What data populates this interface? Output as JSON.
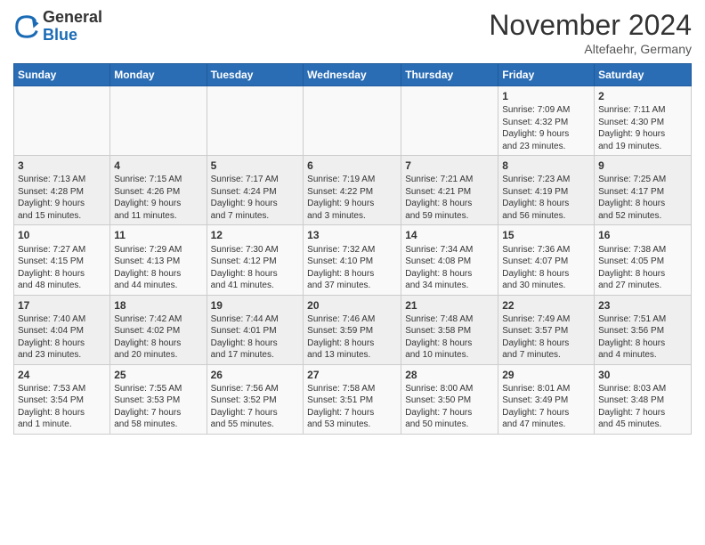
{
  "header": {
    "logo_line1": "General",
    "logo_line2": "Blue",
    "month_title": "November 2024",
    "location": "Altefaehr, Germany"
  },
  "days_of_week": [
    "Sunday",
    "Monday",
    "Tuesday",
    "Wednesday",
    "Thursday",
    "Friday",
    "Saturday"
  ],
  "weeks": [
    {
      "days": [
        {
          "num": "",
          "info": ""
        },
        {
          "num": "",
          "info": ""
        },
        {
          "num": "",
          "info": ""
        },
        {
          "num": "",
          "info": ""
        },
        {
          "num": "",
          "info": ""
        },
        {
          "num": "1",
          "info": "Sunrise: 7:09 AM\nSunset: 4:32 PM\nDaylight: 9 hours\nand 23 minutes."
        },
        {
          "num": "2",
          "info": "Sunrise: 7:11 AM\nSunset: 4:30 PM\nDaylight: 9 hours\nand 19 minutes."
        }
      ]
    },
    {
      "days": [
        {
          "num": "3",
          "info": "Sunrise: 7:13 AM\nSunset: 4:28 PM\nDaylight: 9 hours\nand 15 minutes."
        },
        {
          "num": "4",
          "info": "Sunrise: 7:15 AM\nSunset: 4:26 PM\nDaylight: 9 hours\nand 11 minutes."
        },
        {
          "num": "5",
          "info": "Sunrise: 7:17 AM\nSunset: 4:24 PM\nDaylight: 9 hours\nand 7 minutes."
        },
        {
          "num": "6",
          "info": "Sunrise: 7:19 AM\nSunset: 4:22 PM\nDaylight: 9 hours\nand 3 minutes."
        },
        {
          "num": "7",
          "info": "Sunrise: 7:21 AM\nSunset: 4:21 PM\nDaylight: 8 hours\nand 59 minutes."
        },
        {
          "num": "8",
          "info": "Sunrise: 7:23 AM\nSunset: 4:19 PM\nDaylight: 8 hours\nand 56 minutes."
        },
        {
          "num": "9",
          "info": "Sunrise: 7:25 AM\nSunset: 4:17 PM\nDaylight: 8 hours\nand 52 minutes."
        }
      ]
    },
    {
      "days": [
        {
          "num": "10",
          "info": "Sunrise: 7:27 AM\nSunset: 4:15 PM\nDaylight: 8 hours\nand 48 minutes."
        },
        {
          "num": "11",
          "info": "Sunrise: 7:29 AM\nSunset: 4:13 PM\nDaylight: 8 hours\nand 44 minutes."
        },
        {
          "num": "12",
          "info": "Sunrise: 7:30 AM\nSunset: 4:12 PM\nDaylight: 8 hours\nand 41 minutes."
        },
        {
          "num": "13",
          "info": "Sunrise: 7:32 AM\nSunset: 4:10 PM\nDaylight: 8 hours\nand 37 minutes."
        },
        {
          "num": "14",
          "info": "Sunrise: 7:34 AM\nSunset: 4:08 PM\nDaylight: 8 hours\nand 34 minutes."
        },
        {
          "num": "15",
          "info": "Sunrise: 7:36 AM\nSunset: 4:07 PM\nDaylight: 8 hours\nand 30 minutes."
        },
        {
          "num": "16",
          "info": "Sunrise: 7:38 AM\nSunset: 4:05 PM\nDaylight: 8 hours\nand 27 minutes."
        }
      ]
    },
    {
      "days": [
        {
          "num": "17",
          "info": "Sunrise: 7:40 AM\nSunset: 4:04 PM\nDaylight: 8 hours\nand 23 minutes."
        },
        {
          "num": "18",
          "info": "Sunrise: 7:42 AM\nSunset: 4:02 PM\nDaylight: 8 hours\nand 20 minutes."
        },
        {
          "num": "19",
          "info": "Sunrise: 7:44 AM\nSunset: 4:01 PM\nDaylight: 8 hours\nand 17 minutes."
        },
        {
          "num": "20",
          "info": "Sunrise: 7:46 AM\nSunset: 3:59 PM\nDaylight: 8 hours\nand 13 minutes."
        },
        {
          "num": "21",
          "info": "Sunrise: 7:48 AM\nSunset: 3:58 PM\nDaylight: 8 hours\nand 10 minutes."
        },
        {
          "num": "22",
          "info": "Sunrise: 7:49 AM\nSunset: 3:57 PM\nDaylight: 8 hours\nand 7 minutes."
        },
        {
          "num": "23",
          "info": "Sunrise: 7:51 AM\nSunset: 3:56 PM\nDaylight: 8 hours\nand 4 minutes."
        }
      ]
    },
    {
      "days": [
        {
          "num": "24",
          "info": "Sunrise: 7:53 AM\nSunset: 3:54 PM\nDaylight: 8 hours\nand 1 minute."
        },
        {
          "num": "25",
          "info": "Sunrise: 7:55 AM\nSunset: 3:53 PM\nDaylight: 7 hours\nand 58 minutes."
        },
        {
          "num": "26",
          "info": "Sunrise: 7:56 AM\nSunset: 3:52 PM\nDaylight: 7 hours\nand 55 minutes."
        },
        {
          "num": "27",
          "info": "Sunrise: 7:58 AM\nSunset: 3:51 PM\nDaylight: 7 hours\nand 53 minutes."
        },
        {
          "num": "28",
          "info": "Sunrise: 8:00 AM\nSunset: 3:50 PM\nDaylight: 7 hours\nand 50 minutes."
        },
        {
          "num": "29",
          "info": "Sunrise: 8:01 AM\nSunset: 3:49 PM\nDaylight: 7 hours\nand 47 minutes."
        },
        {
          "num": "30",
          "info": "Sunrise: 8:03 AM\nSunset: 3:48 PM\nDaylight: 7 hours\nand 45 minutes."
        }
      ]
    }
  ]
}
